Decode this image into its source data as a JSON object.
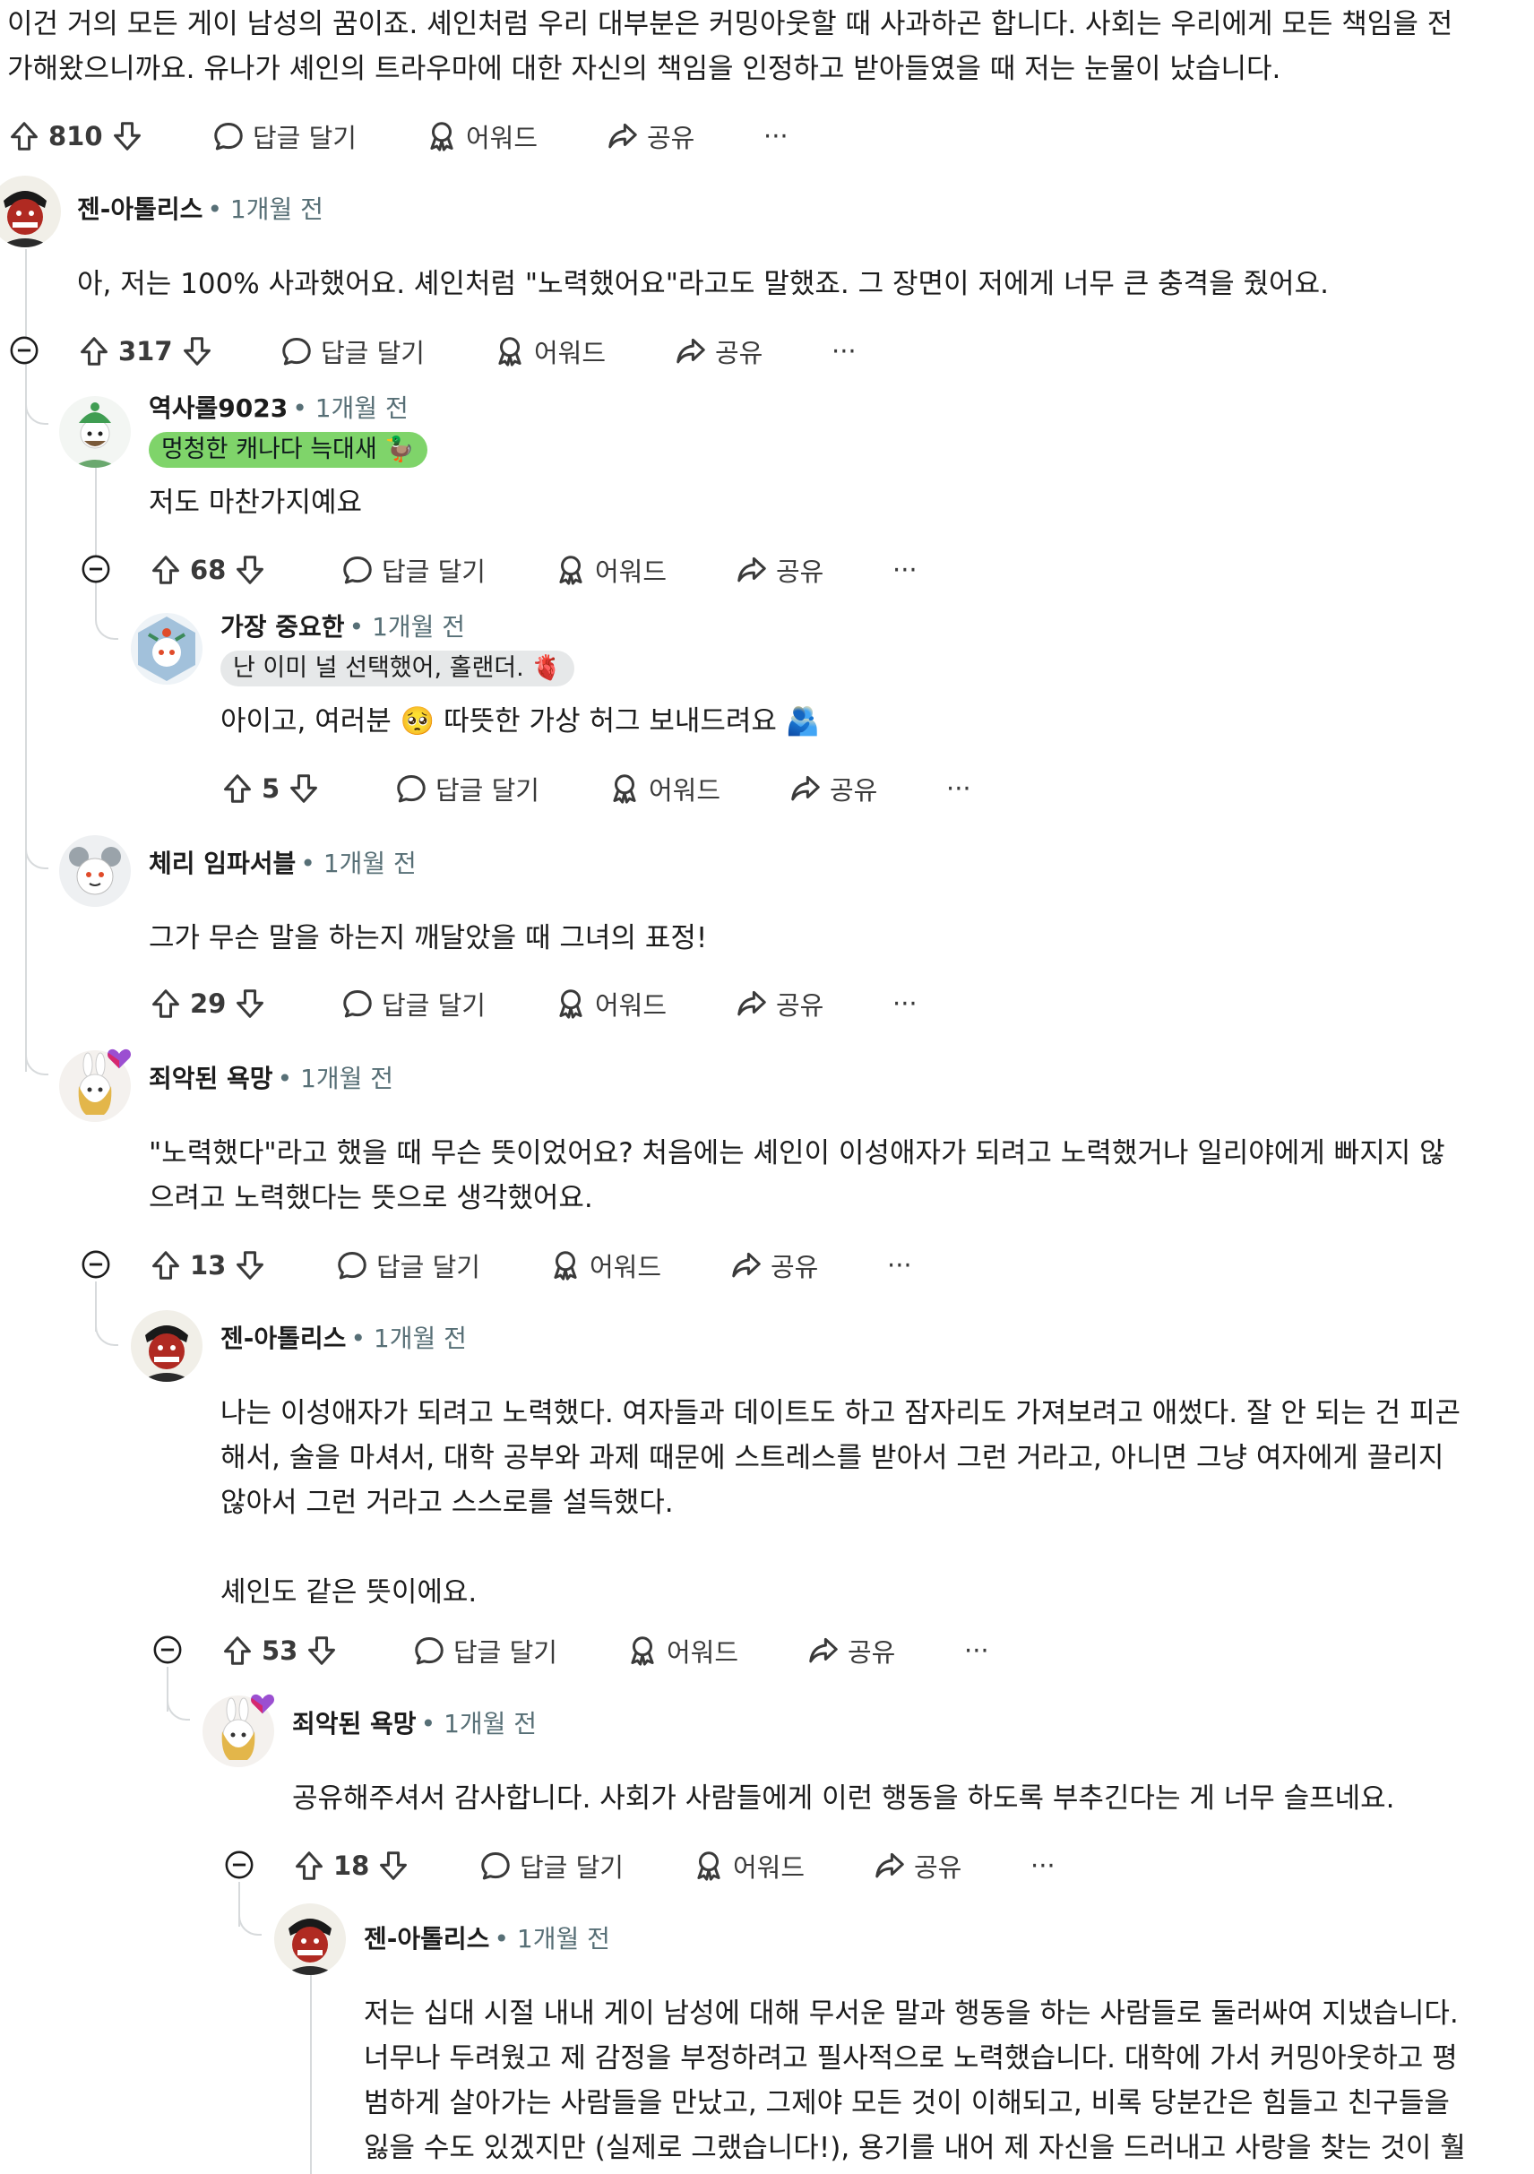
{
  "top_post": {
    "text": "이건 거의 모든 게이 남성의 꿈이죠. 셰인처럼 우리 대부분은 커밍아웃할 때 사과하곤 합니다. 사회는 우리에게 모든 책임을 전\n가해왔으니까요. 유나가 셰인의 트라우마에 대한 자신의 책임을 인정하고 받아들였을 때 저는 눈물이 났습니다.",
    "votes": "810"
  },
  "labels": {
    "reply": "답글 달기",
    "award": "어워드",
    "share": "공유",
    "more": "···"
  },
  "comments": [
    {
      "user": "젠-아톨리스",
      "time": "• 1개월 전",
      "text": "아, 저는 100% 사과했어요. 셰인처럼 \"노력했어요\"라고도 말했죠. 그 장면이 저에게 너무 큰 충격을 줬어요.",
      "votes": "317"
    },
    {
      "user": "역사롤9023",
      "time": "• 1개월 전",
      "flair": "멍청한 캐나다 늑대새 🦆",
      "text": "저도 마찬가지예요",
      "votes": "68"
    },
    {
      "user": "가장 중요한",
      "time": "• 1개월 전",
      "flair": "난 이미 널 선택했어, 홀랜더. 🫀",
      "text": "아이고, 여러분 🥺 따뜻한 가상 허그 보내드려요 🫂",
      "votes": "5"
    },
    {
      "user": "체리 임파서블",
      "time": "• 1개월 전",
      "text": "그가 무슨 말을 하는지 깨달았을 때 그녀의 표정!",
      "votes": "29"
    },
    {
      "user": "죄악된 욕망",
      "time": "• 1개월 전",
      "text": "\"노력했다\"라고 했을 때 무슨 뜻이었어요? 처음에는 셰인이 이성애자가 되려고 노력했거나 일리야에게 빠지지 않\n으려고 노력했다는 뜻으로 생각했어요.",
      "votes": "13"
    },
    {
      "user": "젠-아톨리스",
      "time": "• 1개월 전",
      "text": "나는 이성애자가 되려고 노력했다. 여자들과 데이트도 하고 잠자리도 가져보려고 애썼다. 잘 안 되는 건 피곤\n해서, 술을 마셔서, 대학 공부와 과제 때문에 스트레스를 받아서 그런 거라고, 아니면 그냥 여자에게 끌리지\n않아서 그런 거라고 스스로를 설득했다.\n\n셰인도 같은 뜻이에요.",
      "votes": "53"
    },
    {
      "user": "죄악된 욕망",
      "time": "• 1개월 전",
      "text": "공유해주셔서 감사합니다. 사회가 사람들에게 이런 행동을 하도록 부추긴다는 게 너무 슬프네요.",
      "votes": "18"
    },
    {
      "user": "젠-아톨리스",
      "time": "• 1개월 전",
      "text": "저는 십대 시절 내내 게이 남성에 대해 무서운 말과 행동을 하는 사람들로 둘러싸여 지냈습니다.\n너무나 두려웠고 제 감정을 부정하려고 필사적으로 노력했습니다. 대학에 가서 커밍아웃하고 평\n범하게 살아가는 사람들을 만났고, 그제야 모든 것이 이해되고, 비록 당분간은 힘들고 친구들을\n잃을 수도 있겠지만 (실제로 그랬습니다!), 용기를 내어 제 자신을 드러내고 사랑을 찾는 것이 훨"
    }
  ],
  "colors": {
    "flair_green": "#7fd46a",
    "flair_gray": "#e6e8e9",
    "thread_line": "#d7dadc"
  }
}
